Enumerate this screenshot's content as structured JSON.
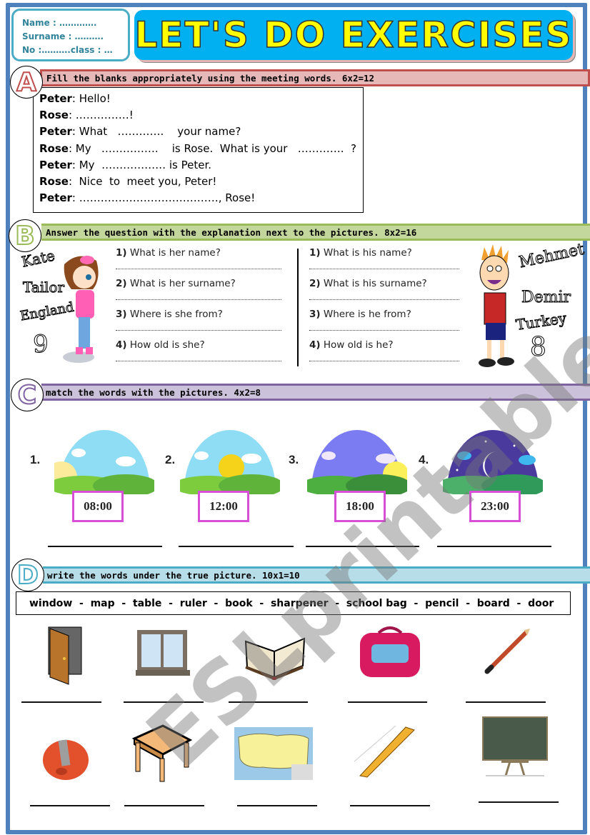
{
  "header": {
    "title": "LET'S DO EXERCISES",
    "info": {
      "name_line": "Name : ………….",
      "surname_line": "Surname : ……….",
      "no_class_line": "No :……….class : …"
    }
  },
  "section_a": {
    "letter": "A",
    "instruction": "Fill the blanks appropriately using the meeting words. 6x2=12",
    "dialogue": [
      {
        "speaker": "Peter",
        "text": ": Hello!"
      },
      {
        "speaker": "Rose",
        "text": ": ……………!"
      },
      {
        "speaker": "Peter",
        "text": ": What   ………….    your name?"
      },
      {
        "speaker": "Rose",
        "text": ": My   …………….    is Rose.  What is your   ………….  ?"
      },
      {
        "speaker": "Peter",
        "text": ": My  ……………… is Peter."
      },
      {
        "speaker": "Rose",
        "text": ":  Nice  to  meet you, Peter!"
      },
      {
        "speaker": "Peter",
        "text": ": …………………………………, Rose!"
      }
    ]
  },
  "section_b": {
    "letter": "B",
    "instruction": "Answer the question with the explanation next to the pictures. 8x2=16",
    "girl": {
      "name": "Kate",
      "surname": "Tailor",
      "country": "England",
      "age": "9",
      "questions": [
        {
          "num": "1)",
          "text": " What is her name?"
        },
        {
          "num": "2)",
          "text": " What is her surname?"
        },
        {
          "num": "3)",
          "text": " Where is she from?"
        },
        {
          "num": "4)",
          "text": " How old is she?"
        }
      ]
    },
    "boy": {
      "name": "Mehmet",
      "surname": "Demir",
      "country": "Turkey",
      "age": "8",
      "questions": [
        {
          "num": "1)",
          "text": " What is his name?"
        },
        {
          "num": "2)",
          "text": " What is his surname?"
        },
        {
          "num": "3)",
          "text": " Where is he from?"
        },
        {
          "num": "4)",
          "text": " How old is he?"
        }
      ]
    }
  },
  "section_c": {
    "letter": "C",
    "instruction": "match the words with the pictures. 4x2=8",
    "items": [
      {
        "num": "1.",
        "time": "08:00",
        "scene": "morning"
      },
      {
        "num": "2.",
        "time": "12:00",
        "scene": "noon"
      },
      {
        "num": "3.",
        "time": "18:00",
        "scene": "evening"
      },
      {
        "num": "4.",
        "time": "23:00",
        "scene": "night"
      }
    ]
  },
  "section_d": {
    "letter": "D",
    "instruction": "write the words under the true picture. 10x1=10",
    "word_bank": "window  -  map  -  table  -  ruler  -  book  -  sharpener  -  school bag  -  pencil  -  board  -  door",
    "pictures": [
      "door",
      "window",
      "book",
      "school bag",
      "pencil",
      "sharpener",
      "table",
      "map",
      "ruler",
      "board"
    ]
  },
  "watermark": "ESLprintables.com",
  "colors": {
    "frame": "#4f81bd",
    "banner": "#00b0f0",
    "title": "#ffff00",
    "section_a": "#c0504d",
    "section_b": "#9bbb59",
    "section_c": "#8064a2",
    "section_d": "#4bacc6",
    "time_box": "#d64fd6"
  }
}
